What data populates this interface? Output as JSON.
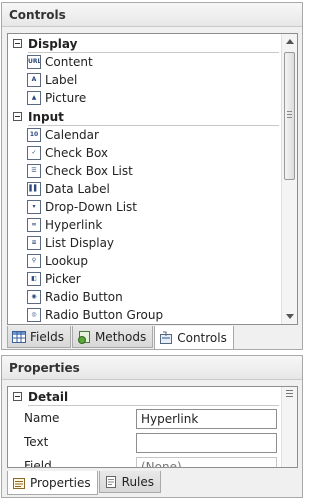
{
  "controls_panel": {
    "title": "Controls",
    "groups": [
      {
        "name": "Display",
        "items": [
          {
            "label": "Content",
            "icon": "url-content-icon",
            "glyph": "URL"
          },
          {
            "label": "Label",
            "icon": "label-icon",
            "glyph": "A"
          },
          {
            "label": "Picture",
            "icon": "picture-icon",
            "glyph": "▲"
          }
        ]
      },
      {
        "name": "Input",
        "items": [
          {
            "label": "Calendar",
            "icon": "calendar-icon",
            "glyph": "10"
          },
          {
            "label": "Check Box",
            "icon": "check-box-icon",
            "glyph": "✓"
          },
          {
            "label": "Check Box List",
            "icon": "check-box-list-icon",
            "glyph": "☰"
          },
          {
            "label": "Data Label",
            "icon": "data-label-icon",
            "glyph": "▌▌"
          },
          {
            "label": "Drop-Down List",
            "icon": "drop-down-list-icon",
            "glyph": "▾"
          },
          {
            "label": "Hyperlink",
            "icon": "hyperlink-icon",
            "glyph": "∞"
          },
          {
            "label": "List Display",
            "icon": "list-display-icon",
            "glyph": "≡"
          },
          {
            "label": "Lookup",
            "icon": "lookup-icon",
            "glyph": "⚲"
          },
          {
            "label": "Picker",
            "icon": "picker-icon",
            "glyph": "◧"
          },
          {
            "label": "Radio Button",
            "icon": "radio-button-icon",
            "glyph": "◉"
          },
          {
            "label": "Radio Button Group",
            "icon": "radio-button-group-icon",
            "glyph": "◎"
          }
        ]
      }
    ],
    "tabs": [
      {
        "label": "Fields",
        "icon": "fields-grid-icon"
      },
      {
        "label": "Methods",
        "icon": "methods-icon"
      },
      {
        "label": "Controls",
        "icon": "controls-icon",
        "active": true
      }
    ]
  },
  "properties_panel": {
    "title": "Properties",
    "section": "Detail",
    "rows": [
      {
        "label": "Name",
        "value": "Hyperlink",
        "placeholder": ""
      },
      {
        "label": "Text",
        "value": "",
        "placeholder": ""
      },
      {
        "label": "Field",
        "value": "",
        "placeholder": "(None)",
        "ellipsis": "..."
      }
    ],
    "tabs": [
      {
        "label": "Properties",
        "icon": "properties-icon",
        "active": true
      },
      {
        "label": "Rules",
        "icon": "rules-icon"
      }
    ]
  }
}
